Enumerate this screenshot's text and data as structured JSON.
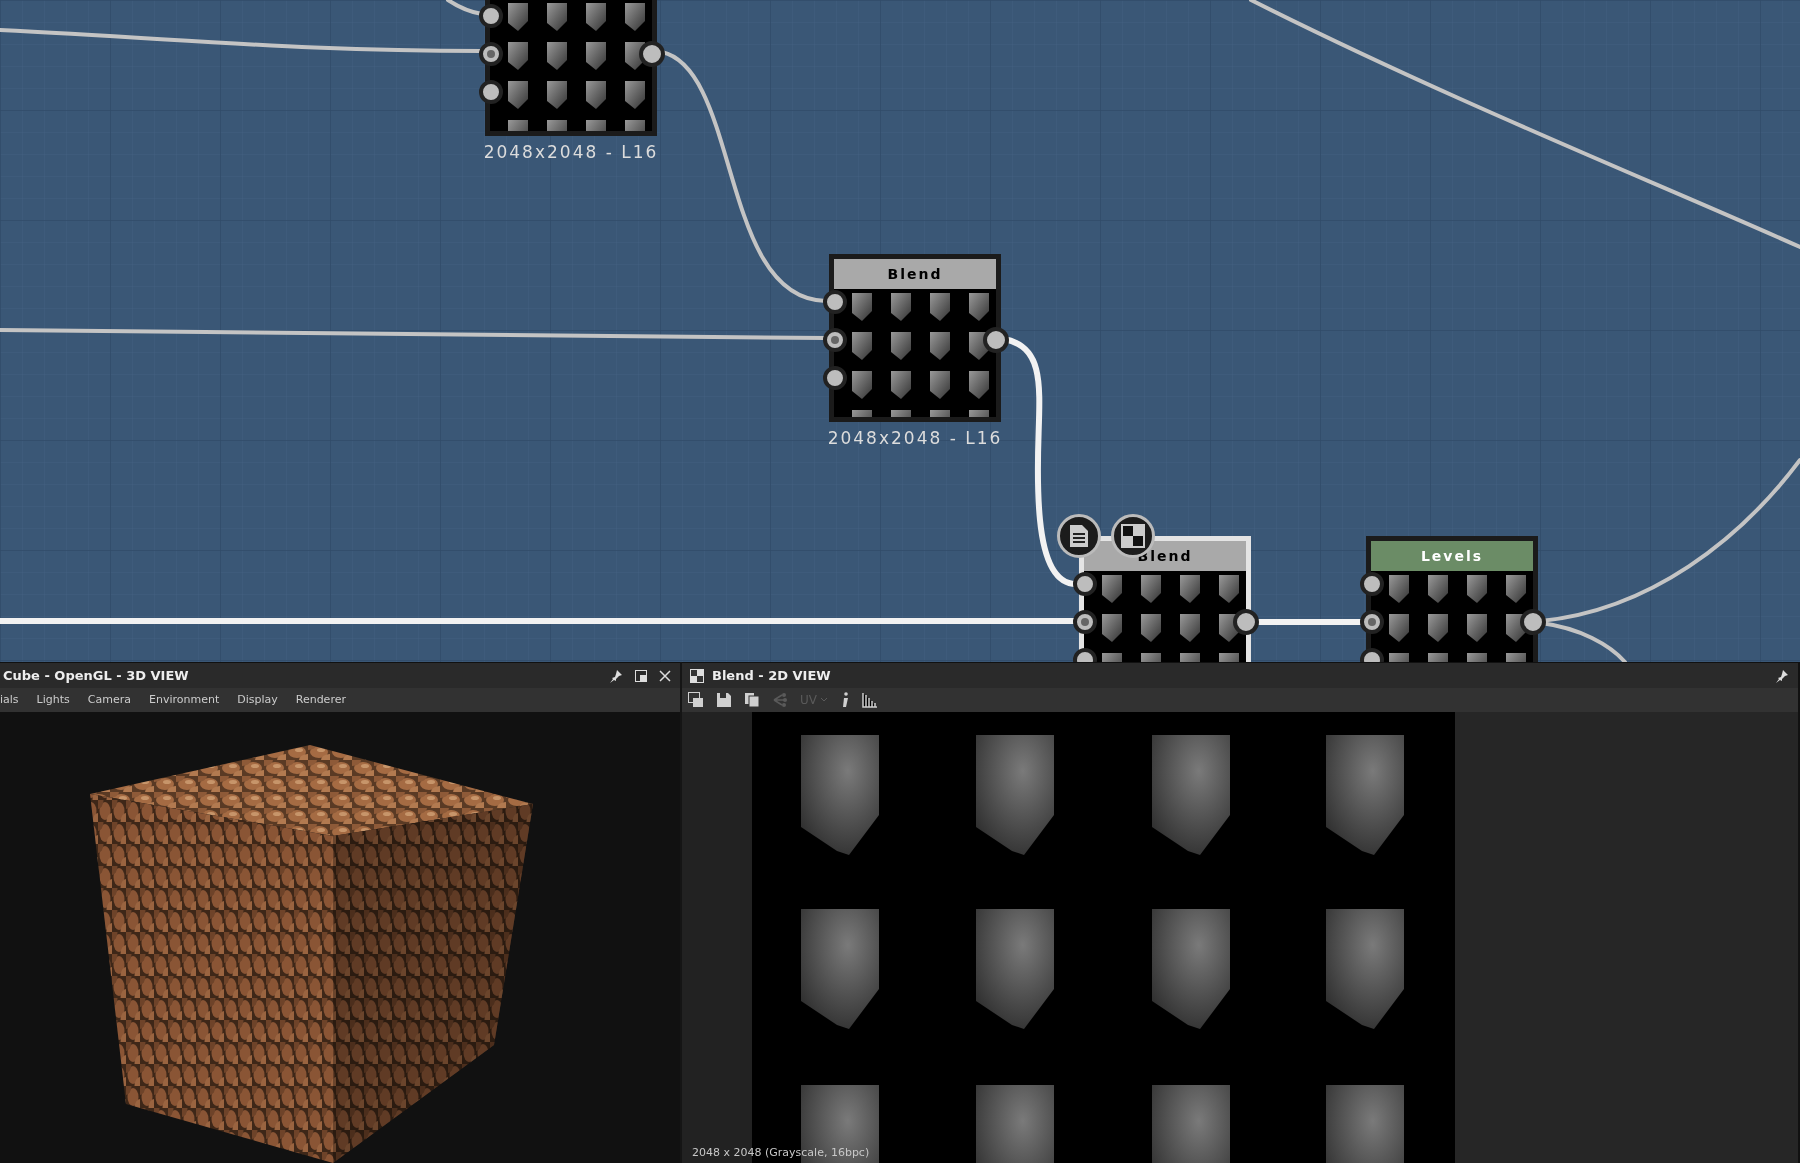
{
  "graph": {
    "nodes": [
      {
        "resolution": "2048x2048 - L16",
        "selected": false
      },
      {
        "title": "Blend",
        "color": "#a9a9a9",
        "resolution": "2048x2048 - L16",
        "selected": false
      },
      {
        "title": "Blend",
        "color": "#a9a9a9",
        "selected": true
      },
      {
        "title": "Levels",
        "color": "#6b8c66",
        "selected": false
      }
    ]
  },
  "panels": [
    {
      "kind": "model",
      "title": "Cube - OpenGL - 3D VIEW",
      "menu": [
        "ials",
        "Lights",
        "Camera",
        "Environment",
        "Display",
        "Renderer"
      ]
    },
    {
      "kind": "image",
      "title": "Blend - 2D VIEW",
      "toolbar": [
        {
          "kind": "view",
          "disabled": false
        },
        {
          "kind": "save",
          "disabled": false
        },
        {
          "kind": "copy",
          "disabled": false
        },
        {
          "kind": "graph",
          "disabled": true
        },
        {
          "kind": "uv",
          "label": "UV",
          "disabled": true
        },
        {
          "kind": "info",
          "disabled": false
        },
        {
          "kind": "histogram",
          "disabled": false
        }
      ],
      "status": "2048 x 2048 (Grayscale, 16bpc)"
    }
  ]
}
